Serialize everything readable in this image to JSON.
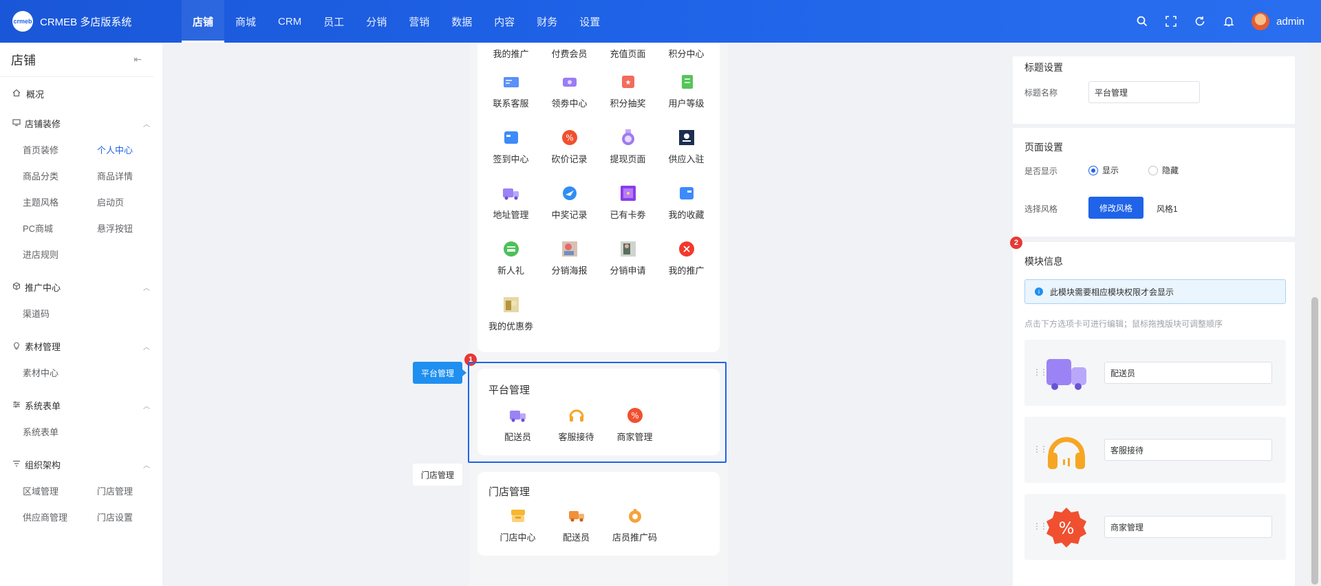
{
  "brand": {
    "logo_text": "crmeb",
    "name": "CRMEB 多店版系统"
  },
  "topnav": [
    {
      "label": "店铺",
      "active": true
    },
    {
      "label": "商城"
    },
    {
      "label": "CRM"
    },
    {
      "label": "员工"
    },
    {
      "label": "分销"
    },
    {
      "label": "营销"
    },
    {
      "label": "数据"
    },
    {
      "label": "内容"
    },
    {
      "label": "财务"
    },
    {
      "label": "设置"
    }
  ],
  "user": {
    "name": "admin"
  },
  "sidebar": {
    "title": "店铺",
    "overview": "概况",
    "groups": [
      {
        "label": "店铺装修",
        "items": [
          "首页装修",
          "个人中心",
          "商品分类",
          "商品详情",
          "主题风格",
          "启动页",
          "PC商城",
          "悬浮按钮",
          "进店规则"
        ]
      },
      {
        "label": "推广中心",
        "items": [
          "渠道码"
        ]
      },
      {
        "label": "素材管理",
        "items": [
          "素材中心"
        ]
      },
      {
        "label": "系统表单",
        "items": [
          "系统表单"
        ]
      },
      {
        "label": "组织架构",
        "items": [
          "区域管理",
          "门店管理",
          "供应商管理",
          "门店设置"
        ]
      }
    ],
    "active_item": "个人中心"
  },
  "preview": {
    "grid_labels": [
      "我的推广",
      "付费会员",
      "充值页面",
      "积分中心",
      "联系客服",
      "领劵中心",
      "积分抽奖",
      "用户等级",
      "签到中心",
      "砍价记录",
      "提现页面",
      "供应入驻",
      "地址管理",
      "中奖记录",
      "已有卡劵",
      "我的收藏",
      "新人礼",
      "分销海报",
      "分销申请",
      "我的推广",
      "我的优惠劵"
    ],
    "platform": {
      "tag": "平台管理",
      "title": "平台管理",
      "badge": "1",
      "items": [
        "配送员",
        "客服接待",
        "商家管理"
      ]
    },
    "store": {
      "tag": "门店管理",
      "title": "门店管理",
      "items": [
        "门店中心",
        "配送员",
        "店员推广码"
      ]
    }
  },
  "right": {
    "title_section": {
      "heading": "标题设置",
      "name_label": "标题名称",
      "name_value": "平台管理"
    },
    "page_section": {
      "heading": "页面设置",
      "show_label": "是否显示",
      "show_on": "显示",
      "show_off": "隐藏",
      "style_label": "选择风格",
      "style_button": "修改风格",
      "style_value": "风格1"
    },
    "module_section": {
      "badge": "2",
      "heading": "模块信息",
      "info": "此模块需要相应模块权限才会显示",
      "hint": "点击下方选项卡可进行编辑；鼠标拖拽版块可调整顺序",
      "items": [
        "配送员",
        "客服接待",
        "商家管理"
      ]
    }
  },
  "colors": {
    "primary": "#1f63e8",
    "badge": "#e63935",
    "info_bg": "#eaf5fd"
  }
}
